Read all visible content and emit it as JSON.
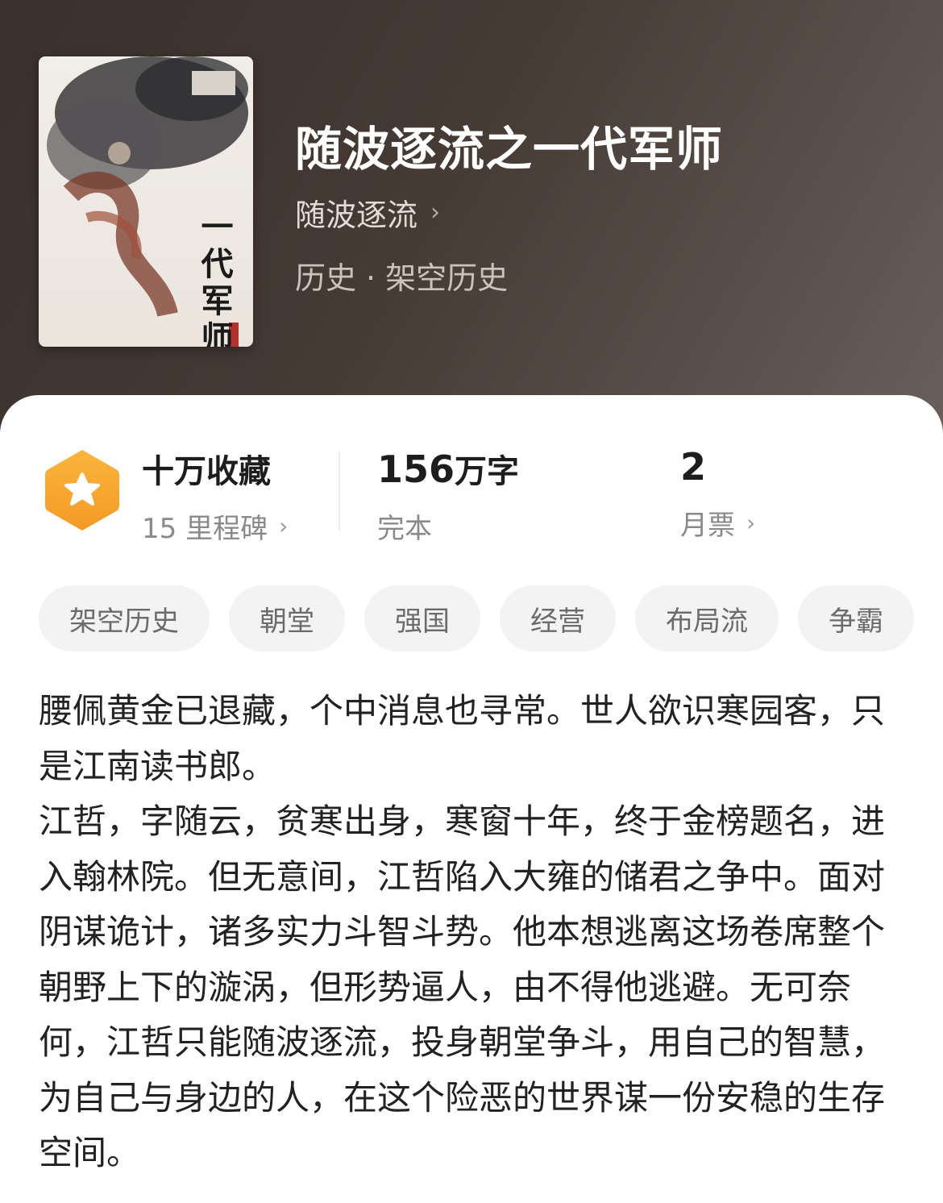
{
  "book": {
    "title": "随波逐流之一代军师",
    "author": "随波逐流",
    "category": "历史",
    "subcategory": "架空历史",
    "separator": "·",
    "cover_title": "一代军师"
  },
  "stats": {
    "favorites": {
      "label": "十万收藏",
      "sub": "15 里程碑"
    },
    "words": {
      "number": "156",
      "unit": "万字",
      "status": "完本"
    },
    "monthly_ticket": {
      "value": "2",
      "label": "月票"
    }
  },
  "tags": [
    "架空历史",
    "朝堂",
    "强国",
    "经营",
    "布局流",
    "争霸"
  ],
  "description": {
    "paragraphs": [
      "腰佩黄金已退藏，个中消息也寻常。世人欲识寒园客，只是江南读书郎。",
      "江哲，字随云，贫寒出身，寒窗十年，终于金榜题名，进入翰林院。但无意间，江哲陷入大雍的储君之争中。面对阴谋诡计，诸多实力斗智斗势。他本想逃离这场卷席整个朝野上下的漩涡，但形势逼人，由不得他逃避。无可奈何，江哲只能随波逐流，投身朝堂争斗，用自己的智慧，为自己与身边的人，在这个险恶的世界谋一份安稳的生存空间。"
    ]
  },
  "colors": {
    "hero_bg": "#463a35",
    "badge_orange": "#f7a62f",
    "text_primary": "#1d1d1d",
    "text_secondary": "#8a8a8a",
    "tag_bg": "#f3f3f3"
  },
  "icons": {
    "chevron": "chevron-right-icon",
    "badge": "star-hexagon-badge-icon"
  }
}
